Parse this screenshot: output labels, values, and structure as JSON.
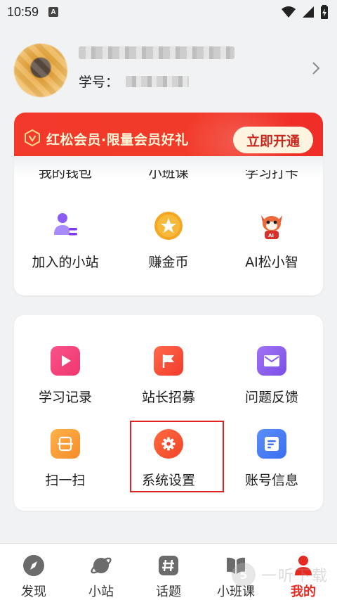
{
  "status_bar": {
    "time": "10:59",
    "badge": "A"
  },
  "profile": {
    "student_id_label": "学号："
  },
  "vip": {
    "text": "红松会员·限量会员好礼",
    "button": "立即开通",
    "colors": {
      "banner": "#f2392b",
      "button_bg": "#fff4e0",
      "button_text": "#c8271e"
    }
  },
  "card1": {
    "cut_labels": [
      "我的钱包",
      "小班课",
      "学习打卡"
    ],
    "items": [
      {
        "label": "加入的小站",
        "icon": "joined-stations-icon"
      },
      {
        "label": "赚金币",
        "icon": "coin-star-icon"
      },
      {
        "label": "AI松小智",
        "icon": "squirrel-mascot-icon"
      }
    ]
  },
  "card2": {
    "items": [
      {
        "label": "学习记录",
        "icon": "play-record-icon"
      },
      {
        "label": "站长招募",
        "icon": "flag-icon"
      },
      {
        "label": "问题反馈",
        "icon": "mail-icon"
      },
      {
        "label": "扫一扫",
        "icon": "scan-icon"
      },
      {
        "label": "系统设置",
        "icon": "gear-icon"
      },
      {
        "label": "账号信息",
        "icon": "account-info-icon"
      }
    ]
  },
  "bottom_nav": {
    "items": [
      {
        "label": "发现",
        "icon": "compass-icon"
      },
      {
        "label": "小站",
        "icon": "planet-icon"
      },
      {
        "label": "话题",
        "icon": "hashtag-icon"
      },
      {
        "label": "小班课",
        "icon": "book-icon"
      },
      {
        "label": "我的",
        "icon": "person-icon",
        "active": true
      }
    ],
    "active_color": "#e62a22"
  },
  "watermark": {
    "logo": "5",
    "text": "一听下载"
  }
}
